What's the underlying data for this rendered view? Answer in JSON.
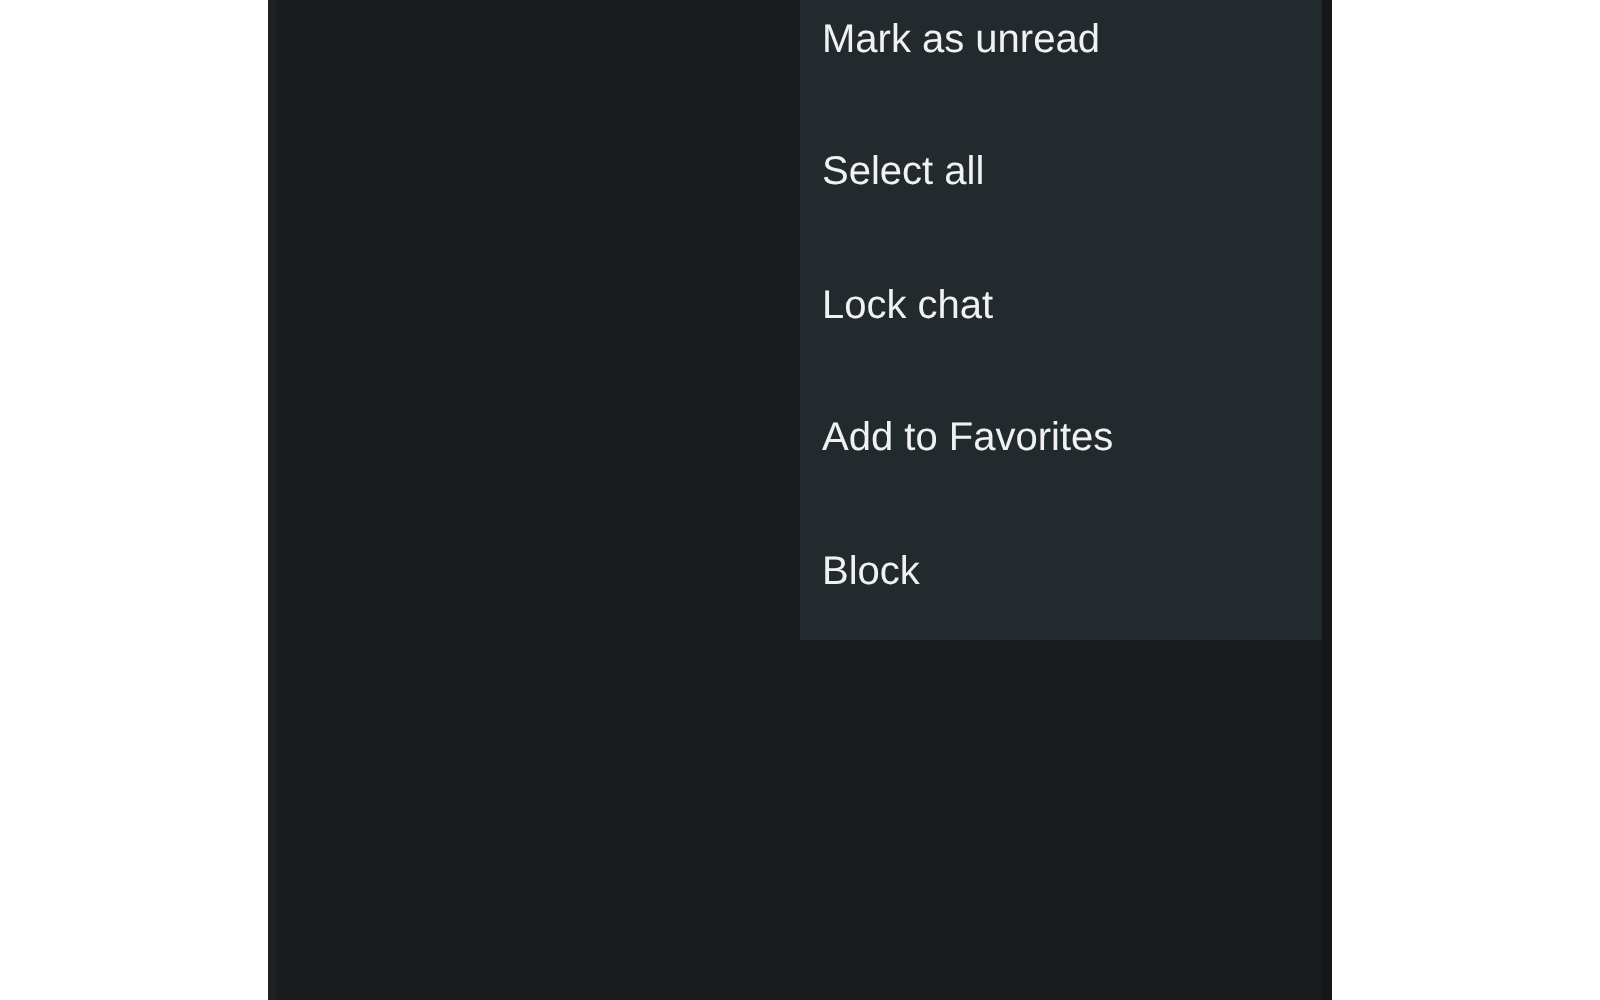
{
  "menu": {
    "items": [
      {
        "label": "Mark as unread"
      },
      {
        "label": "Select all"
      },
      {
        "label": "Lock chat"
      },
      {
        "label": "Add to Favorites"
      },
      {
        "label": "Block"
      }
    ]
  }
}
